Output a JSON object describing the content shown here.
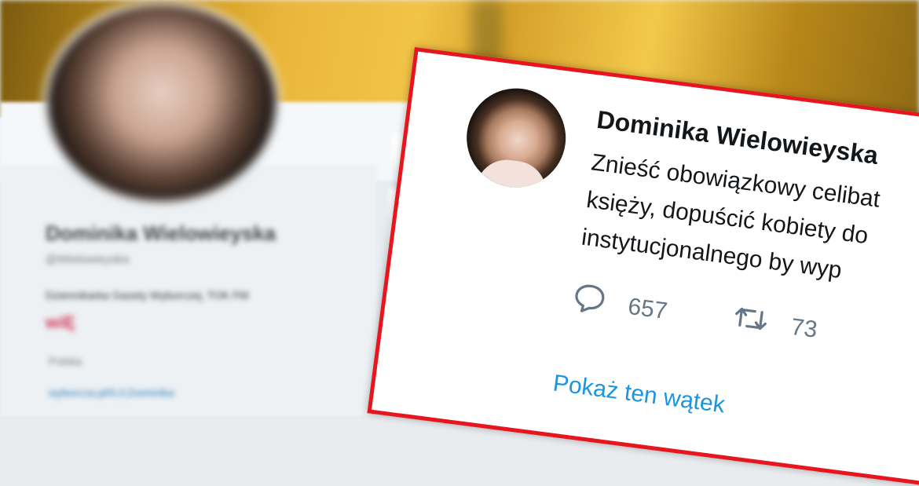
{
  "tweet": {
    "author_name": "Dominika Wielowieyska",
    "text_lines": [
      "Znieść obowiązkowy celibat",
      "księży, dopuścić kobiety do",
      "instytucjonalnego by wyp"
    ],
    "reply_count": "657",
    "retweet_count": "73",
    "show_thread_label": "Pokaż ten wątek"
  },
  "background_profile": {
    "name": "Dominika Wielowieyska",
    "handle": "@Wielowieyska",
    "bio": "Dziennikarka Gazety Wyborczej, TOK FM",
    "highlight": "wiĘ",
    "location": "Polska",
    "link": "wyborcza.pl/0,0,Dominika"
  },
  "colors": {
    "frame": "#e5161d",
    "link": "#1b95e0",
    "action": "#657786"
  },
  "icons": {
    "reply": "speech-bubble-icon",
    "retweet": "retweet-arrows-icon"
  }
}
